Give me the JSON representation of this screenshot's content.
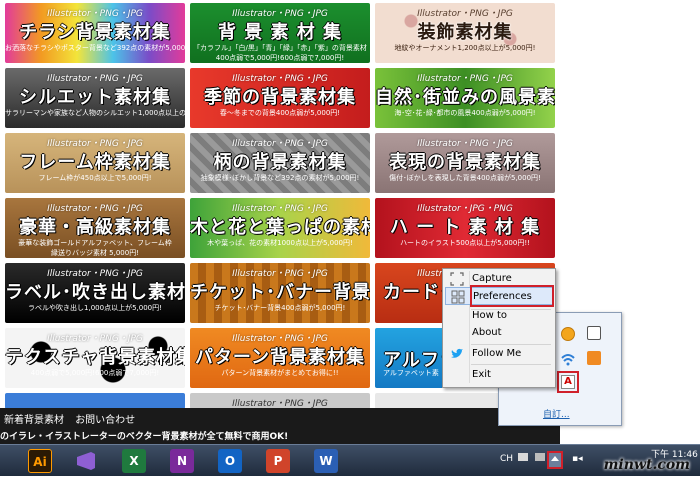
{
  "banners": [
    {
      "sub": "Illustrator・PNG・JPG",
      "title": "チラシ背景素材集",
      "desc": "お洒落なチラシやポスター背景など392点の素材が5,000円!"
    },
    {
      "sub": "Illustrator・PNG・JPG",
      "title": "背 景 素 材 集",
      "desc": "「カラフル」「白/黒」「青」「緑」「赤」「紫」の背景素材",
      "desc2": "400点弱で5,000円!600点弱で7,000円!"
    },
    {
      "sub": "Illustrator・PNG・JPG",
      "title": "装飾素材集",
      "desc": "地紋やオーナメント1,200点以上が5,000円!"
    },
    {
      "sub": "Illustrator・PNG・JPG",
      "title": "シルエット素材集",
      "desc": "サラリーマンや家族など人物のシルエット1,000点以上の素材が5,000円!"
    },
    {
      "sub": "Illustrator・PNG・JPG",
      "title": "季節の背景素材集",
      "desc": "春～冬までの背景400点弱が5,000円!"
    },
    {
      "sub": "Illustrator・PNG・JPG",
      "title": "自然･街並みの風景素材集",
      "desc": "海･空･花･緑･都市の風景400点弱が5,000円!"
    },
    {
      "sub": "Illustrator・PNG・JPG",
      "title": "フレーム枠素材集",
      "desc": "フレーム枠が450点以上で5,000円!"
    },
    {
      "sub": "Illustrator・PNG・JPG",
      "title": "柄の背景素材集",
      "desc": "抽象模様･ぼかし背景など392点の素材が5,000円!"
    },
    {
      "sub": "Illustrator・PNG・JPG",
      "title": "表現の背景素材集",
      "desc": "傷付･ぼかしを表現した背景400点弱が5,000円!"
    },
    {
      "sub": "Illustrator・PNG・JPG",
      "title": "豪華・高級素材集",
      "desc": "豪華な装飾ゴールドアルファベット、フレーム枠",
      "desc2": "縁送りバッジ素材 5,000円!"
    },
    {
      "sub": "Illustrator・PNG・JPG",
      "title": "木と花と葉っぱの素材集",
      "desc": "木や葉っぱ、花の素材1000点以上が5,000円!"
    },
    {
      "sub": "Illustrator・JPG・PNG",
      "title": "ハ ー ト 素 材 集",
      "desc": "ハートのイラスト500点以上が5,000円!!"
    },
    {
      "sub": "Illustrator・PNG・JPG",
      "title": "ラベル･吹き出し素材集",
      "desc": "ラベルや吹き出し1,000点以上が5,000円!"
    },
    {
      "sub": "Illustrator・PNG・JPG",
      "title": "チケット･バナー背景素材集",
      "desc": "チケット･バナー背景400点弱が5,000円!"
    },
    {
      "sub": "Illustrator・PNG・JPG",
      "title": "カード･名",
      "desc": ""
    },
    {
      "sub": "Illustrator・PNG・JPG",
      "title": "テクスチャ背景素材集",
      "desc": "400点弱で5,000円!600点弱で7,000円!"
    },
    {
      "sub": "Illustrator・PNG・JPG",
      "title": "パターン背景素材集",
      "desc": "パターン背景素材がまとめてお得に!!"
    },
    {
      "sub": "",
      "title": "アルファ",
      "desc": "アルファベット素"
    },
    {
      "sub": "",
      "title": "",
      "desc": ""
    },
    {
      "sub": "Illustrator・PNG・JPG",
      "title": "",
      "desc": ""
    },
    {
      "sub": "",
      "title": "",
      "desc": ""
    }
  ],
  "footer": {
    "link1": "新着背景素材",
    "link2": "お問い合わせ",
    "tagline": "のイラレ・イラストレーターのベクター背景素材が全て無料で商用OK!"
  },
  "context_menu": {
    "items": [
      {
        "label": "Capture",
        "icon": "capture-icon"
      },
      {
        "label": "Preferences",
        "icon": "preferences-icon"
      },
      {
        "label": "How to"
      },
      {
        "label": "About"
      },
      {
        "label": "Follow Me",
        "icon": "twitter-bird-icon"
      },
      {
        "label": "Exit"
      }
    ]
  },
  "tray_popup": {
    "customize": "自訂..."
  },
  "taskbar": {
    "lang": "CH",
    "clock": "下午 11:46",
    "apps": [
      "Ai",
      "VS",
      "X",
      "N",
      "O",
      "P",
      "W"
    ]
  },
  "watermark": "minwt.com",
  "colors": {
    "highlight_border": "#d0202a",
    "menu_hover": "#dde9fa"
  }
}
